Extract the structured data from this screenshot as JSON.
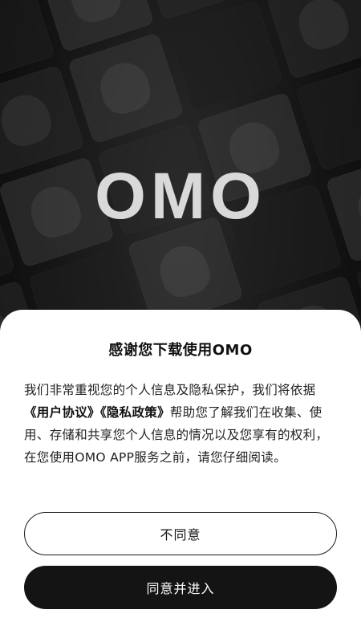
{
  "brand": {
    "logo_text": "OMO"
  },
  "dialog": {
    "title": "感谢您下载使用OMO",
    "body_before": "我们非常重视您的个人信息及隐私保护，我们将依据",
    "user_agreement_link": "《用户协议》",
    "privacy_policy_link": "《隐私政策》",
    "body_after": "帮助您了解我们在收集、使用、存储和共享您个人信息的情况以及您享有的权利，在您使用OMO APP服务之前，请您仔细阅读。",
    "decline_label": "不同意",
    "agree_label": "同意并进入"
  },
  "colors": {
    "background": "#0c0c0c",
    "sheet": "#ffffff",
    "primary_button": "#141414",
    "logo": "#d9d9d9"
  }
}
